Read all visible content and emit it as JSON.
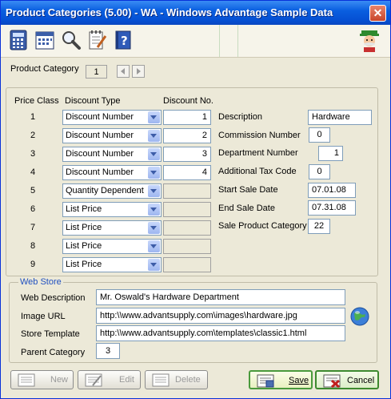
{
  "window": {
    "title": "Product Categories (5.00) - WA - Windows Advantage Sample Data",
    "close_glyph": "✕"
  },
  "toolbar": {
    "icons": [
      "calculator-icon",
      "calendar-icon",
      "magnifier-icon",
      "notepad-icon",
      "help-book-icon"
    ],
    "mascot_icon": "cartoon-guy-icon"
  },
  "header": {
    "product_category_label": "Product Category",
    "product_category_value": "1"
  },
  "price_table": {
    "col_price_class": "Price Class",
    "col_discount_type": "Discount Type",
    "col_discount_no": "Discount No.",
    "rows": [
      {
        "cls": "1",
        "type": "Discount Number",
        "no": "1"
      },
      {
        "cls": "2",
        "type": "Discount Number",
        "no": "2"
      },
      {
        "cls": "3",
        "type": "Discount Number",
        "no": "3"
      },
      {
        "cls": "4",
        "type": "Discount Number",
        "no": "4"
      },
      {
        "cls": "5",
        "type": "Quantity Dependent",
        "no": ""
      },
      {
        "cls": "6",
        "type": "List Price",
        "no": ""
      },
      {
        "cls": "7",
        "type": "List Price",
        "no": ""
      },
      {
        "cls": "8",
        "type": "List Price",
        "no": ""
      },
      {
        "cls": "9",
        "type": "List Price",
        "no": ""
      }
    ]
  },
  "details": {
    "description_label": "Description",
    "description_value": "Hardware",
    "commission_label": "Commission Number",
    "commission_value": "0",
    "department_label": "Department Number",
    "department_value": "1",
    "addtax_label": "Additional Tax Code",
    "addtax_value": "0",
    "start_label": "Start Sale Date",
    "start_value": "07.01.08",
    "end_label": "End Sale Date",
    "end_value": "07.31.08",
    "salecat_label": "Sale Product Category",
    "salecat_value": "22"
  },
  "webstore": {
    "title": "Web Store",
    "desc_label": "Web Description",
    "desc_value": "Mr. Oswald's Hardware Department",
    "image_label": "Image URL",
    "image_value": "http:\\\\www.advantsupply.com\\images\\hardware.jpg",
    "template_label": "Store Template",
    "template_value": "http:\\\\www.advantsupply.com\\templates\\classic1.html",
    "parent_label": "Parent Category",
    "parent_value": "3"
  },
  "buttons": {
    "new": "New",
    "edit": "Edit",
    "delete": "Delete",
    "save": "Save",
    "cancel": "Cancel"
  }
}
